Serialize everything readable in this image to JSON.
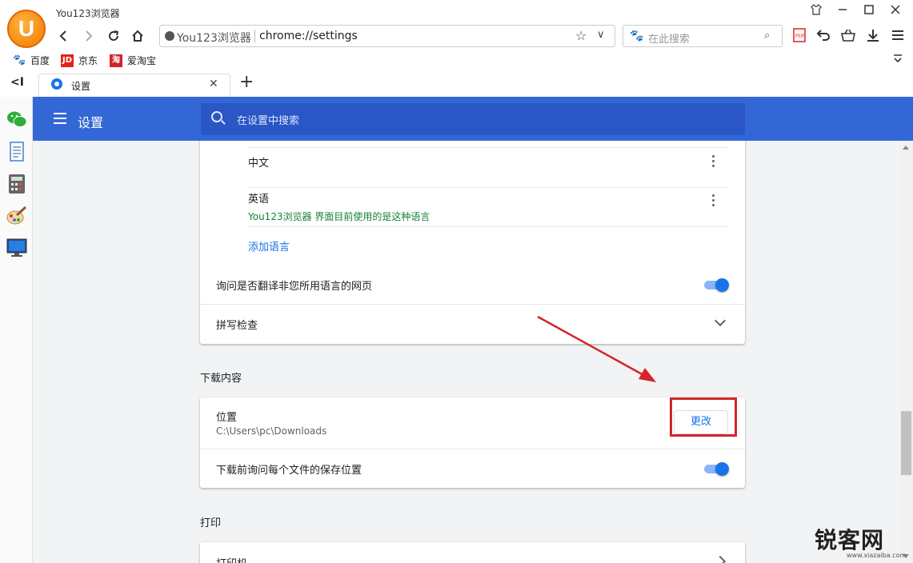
{
  "window": {
    "title": "You123浏览器",
    "logo_letter": "U"
  },
  "address_bar": {
    "site": "You123浏览器",
    "url": "chrome://settings"
  },
  "top_search": {
    "placeholder": "在此搜索"
  },
  "bookmarks": [
    {
      "label": "百度",
      "icon": "baidu-paw-icon",
      "color": "#2f75d8"
    },
    {
      "label": "京东",
      "icon": "jd-icon",
      "icon_text": "JD",
      "color": "#e1251b"
    },
    {
      "label": "爱淘宝",
      "icon": "taobao-icon",
      "icon_text": "淘",
      "color": "#d2232a"
    }
  ],
  "tab": {
    "label": "设置"
  },
  "settings": {
    "title": "设置",
    "search_placeholder": "在设置中搜索",
    "languages": [
      {
        "name": "中文",
        "note": ""
      },
      {
        "name": "英语",
        "note": "You123浏览器 界面目前使用的是这种语言"
      }
    ],
    "add_language": "添加语言",
    "translate_prompt": "询问是否翻译非您所用语言的网页",
    "translate_enabled": true,
    "spellcheck": "拼写检查",
    "downloads_section": "下载内容",
    "location_label": "位置",
    "location_path": "C:\\Users\\pc\\Downloads",
    "change_button": "更改",
    "ask_location": "下载前询问每个文件的保存位置",
    "ask_location_enabled": true,
    "print_section": "打印",
    "printer_label": "打印机"
  },
  "watermark": {
    "text": "锐客网",
    "sub": "www.xiazaiba.com"
  },
  "colors": {
    "accent": "#3367d6",
    "highlight": "#d5242a",
    "arrow": "#d5242a"
  }
}
